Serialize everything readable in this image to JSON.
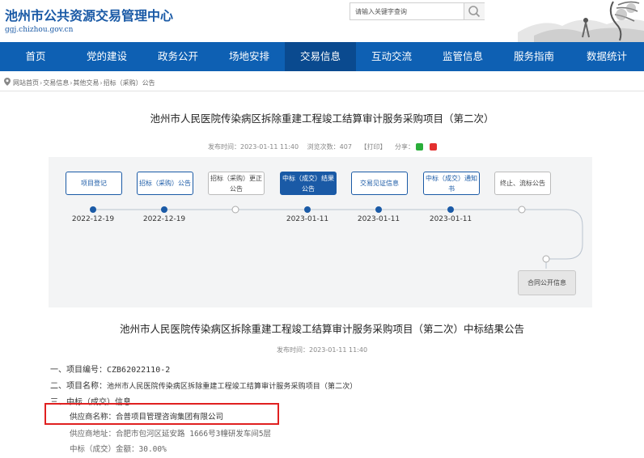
{
  "header": {
    "site_title": "池州市公共资源交易管理中心",
    "site_url": "ggj.chizhou.gov.cn",
    "search_placeholder": "请输入关键字查询"
  },
  "nav": {
    "items": [
      "首页",
      "党的建设",
      "政务公开",
      "场地安排",
      "交易信息",
      "互动交流",
      "监管信息",
      "服务指南",
      "数据统计"
    ],
    "active": "交易信息"
  },
  "breadcrumb": [
    "网站首页",
    "交易信息",
    "其他交易",
    "招标（采购）公告"
  ],
  "article": {
    "title": "池州市人民医院传染病区拆除重建工程竣工结算审计服务采购项目（第二次）",
    "publish_time": "发布时间：2023-01-11 11:40",
    "views": "浏览次数：407",
    "print": "【打印】",
    "share": "分享："
  },
  "timeline": {
    "steps": [
      {
        "label": "项目登记",
        "date": "2022-12-19",
        "state": "done"
      },
      {
        "label": "招标（采购）公告",
        "date": "2022-12-19",
        "state": "done"
      },
      {
        "label": "招标（采购）更正公告",
        "date": "",
        "state": "grey"
      },
      {
        "label": "中标（成交）结果公告",
        "date": "2023-01-11",
        "state": "active"
      },
      {
        "label": "交易见证信息",
        "date": "2023-01-11",
        "state": "done"
      },
      {
        "label": "中标（成交）通知书",
        "date": "2023-01-11",
        "state": "done"
      },
      {
        "label": "终止、流标公告",
        "date": "",
        "state": "grey"
      }
    ],
    "contract_label": "合同公开信息"
  },
  "result": {
    "title": "池州市人民医院传染病区拆除重建工程竣工结算审计服务采购项目（第二次）中标结果公告",
    "publish_time": "发布时间：2023-01-11 11:40",
    "item1_label": "一、项目编号：",
    "item1_value": "CZB62022110-2",
    "item2_label": "二、项目名称：",
    "item2_value": "池州市人民医院传染病区拆除重建工程竣工结算审计服务采购项目（第二次）",
    "item3_label": "三、中标（成交）信息",
    "supplier_name": "供应商名称：合普项目管理咨询集团有限公司",
    "supplier_address": "供应商地址：合肥市包河区延安路 1666号3幢研发车间5层",
    "bid_amount": "中标（成交）金额：30.00%"
  },
  "colors": {
    "brand": "#0e60b3",
    "highlight": "#e02020"
  }
}
